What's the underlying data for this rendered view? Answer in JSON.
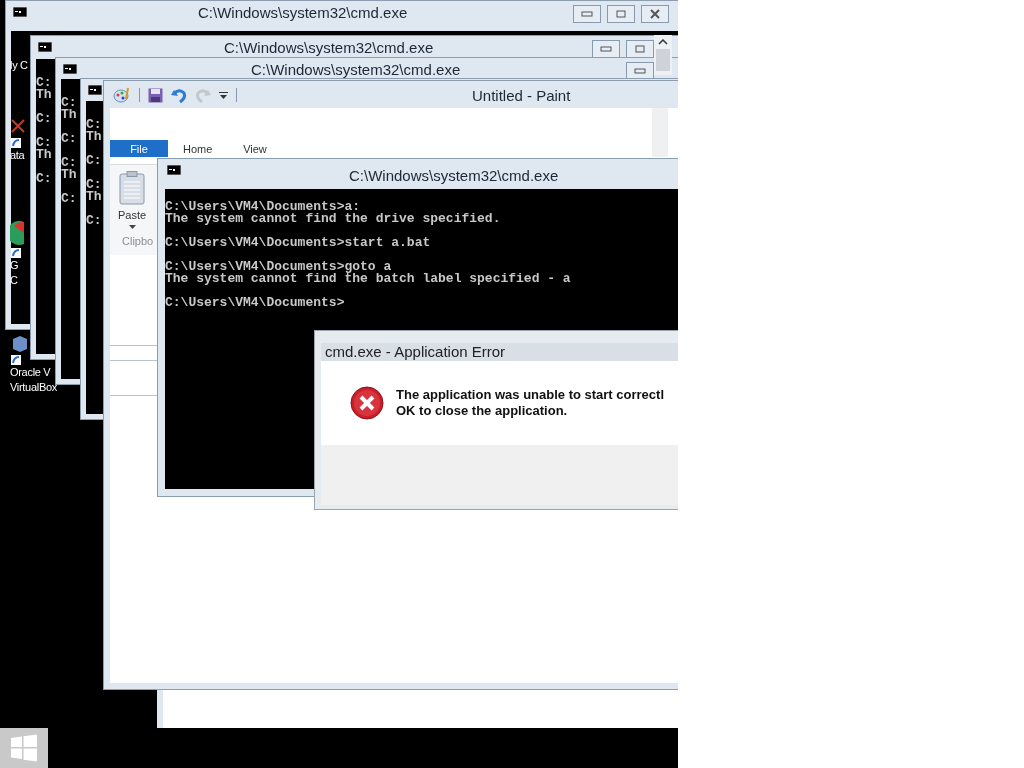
{
  "desktop_icons": [
    {
      "kind": "none",
      "lines": [
        "ly C"
      ]
    },
    {
      "kind": "cross",
      "lines": [
        "ata"
      ]
    },
    {
      "kind": "pie",
      "lines": [
        "G",
        "C"
      ]
    },
    {
      "kind": "box",
      "lines": [
        "Oracle V",
        "VirtualBox"
      ]
    }
  ],
  "console_windows": [
    {
      "title": "C:\\Windows\\system32\\cmd.exe",
      "buttons": [
        {
          "kind": "min"
        },
        {
          "kind": "max"
        },
        {
          "kind": "close"
        }
      ]
    },
    {
      "title": "C:\\Windows\\system32\\cmd.exe",
      "buttons": [
        {
          "kind": "min"
        },
        {
          "kind": "max"
        }
      ],
      "blocks": [
        [
          "C:",
          "Th"
        ],
        [
          "C:"
        ],
        [
          "C:",
          "Th"
        ],
        [
          "C:"
        ]
      ]
    },
    {
      "title": "C:\\Windows\\system32\\cmd.exe",
      "buttons": [
        {
          "kind": "min"
        }
      ],
      "blocks": [
        [
          "C:",
          "Th"
        ],
        [
          "C:"
        ],
        [
          "C:",
          "Th"
        ],
        [
          "C:"
        ]
      ]
    },
    {
      "blocks": [
        [
          "C:",
          "Th"
        ],
        [
          "C:"
        ],
        [
          "C:",
          "Th"
        ],
        [
          "C:"
        ]
      ]
    }
  ],
  "paint": {
    "title": "Untitled - Paint",
    "tabs": [
      {
        "label": "File",
        "selected": true
      },
      {
        "label": "Home",
        "selected": false
      },
      {
        "label": "View",
        "selected": false
      }
    ],
    "paste": "Paste",
    "group": "Clipbo"
  },
  "front_console": {
    "title": "C:\\Windows\\system32\\cmd.exe",
    "blocks": [
      [
        "C:\\Users\\VM4\\Documents>a:",
        "The system cannot find the drive specified."
      ],
      [
        "C:\\Users\\VM4\\Documents>start a.bat"
      ],
      [
        "C:\\Users\\VM4\\Documents>goto a",
        "The system cannot find the batch label specified - a"
      ],
      [
        "C:\\Users\\VM4\\Documents>"
      ]
    ]
  },
  "error_dialog": {
    "title": "cmd.exe - Application Error",
    "lines": [
      "The application was unable to start correctl",
      "OK to close the application."
    ]
  }
}
